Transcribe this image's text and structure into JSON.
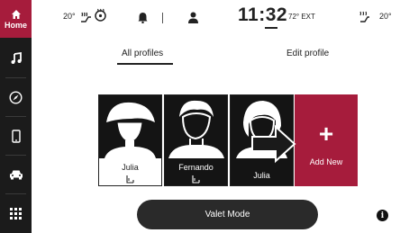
{
  "sidebar": {
    "home_label": "Home",
    "items": [
      {
        "icon": "home-icon",
        "label": "Home"
      },
      {
        "icon": "music-icon"
      },
      {
        "icon": "compass-icon"
      },
      {
        "icon": "phone-icon"
      },
      {
        "icon": "car-icon"
      },
      {
        "icon": "apps-grid-icon"
      }
    ]
  },
  "status": {
    "driver_temp": "20°",
    "passenger_temp": "20°",
    "time": "11:32",
    "exterior_temp": "72° EXT"
  },
  "tabs": {
    "all_profiles": "All profiles",
    "edit_profile": "Edit profile"
  },
  "profiles": [
    {
      "name": "Julia",
      "seat_icon": "seat-icon"
    },
    {
      "name": "Fernando",
      "seat_icon": "seat-icon"
    },
    {
      "name": "Julia"
    }
  ],
  "add_new_label": "Add New",
  "valet_label": "Valet Mode",
  "colors": {
    "accent": "#a61c3c",
    "sidebar_bg": "#1b1b1b",
    "card_dark": "#141414"
  }
}
